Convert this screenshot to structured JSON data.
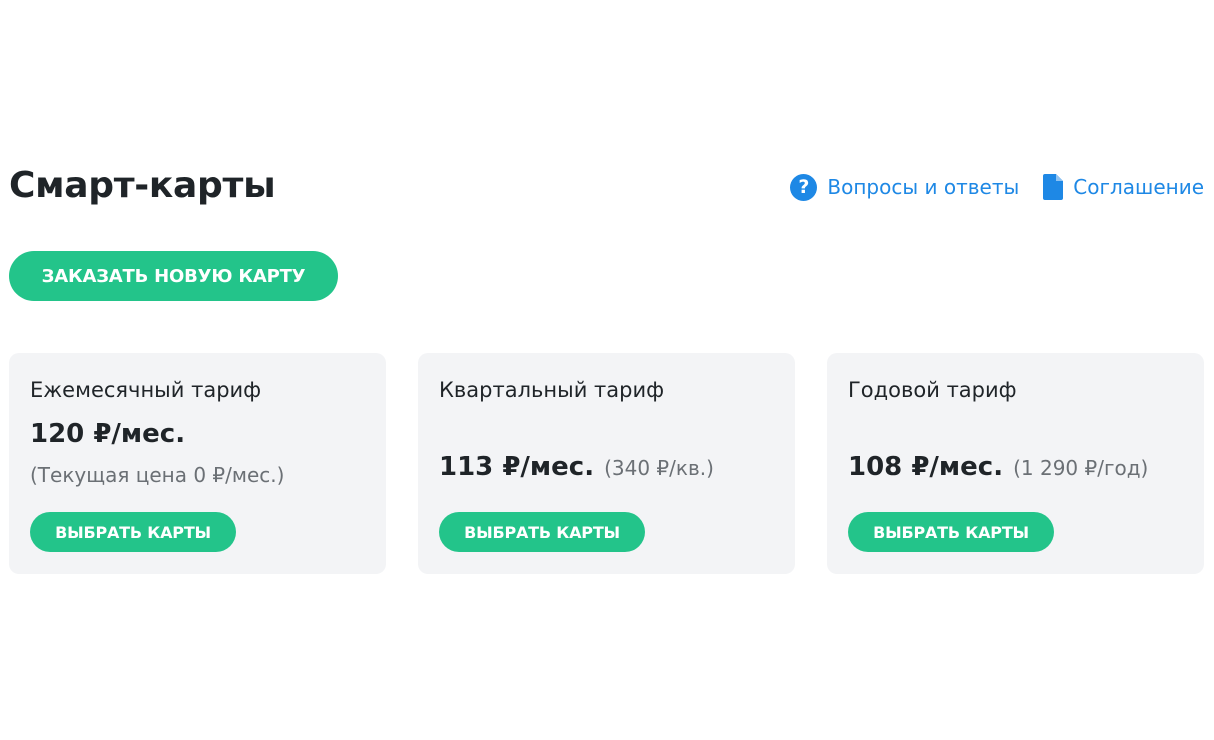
{
  "header": {
    "title": "Смарт-карты",
    "links": [
      {
        "label": "Вопросы и ответы",
        "icon": "help-circle-icon"
      },
      {
        "label": "Соглашение",
        "icon": "document-icon"
      }
    ]
  },
  "order_button": {
    "label": "ЗАКАЗАТЬ НОВУЮ КАРТУ"
  },
  "cards": [
    {
      "title": "Ежемесячный тариф",
      "price": "120 ₽/мес.",
      "note": "(Текущая цена 0 ₽/мес.)",
      "button_label": "ВЫБРАТЬ КАРТЫ"
    },
    {
      "title": "Квартальный тариф",
      "price": "113 ₽/мес.",
      "period_price": "(340 ₽/кв.)",
      "button_label": "ВЫБРАТЬ КАРТЫ"
    },
    {
      "title": "Годовой тариф",
      "price": "108 ₽/мес.",
      "period_price": "(1 290 ₽/год)",
      "button_label": "ВЫБРАТЬ КАРТЫ"
    }
  ],
  "colors": {
    "accent_green": "#23c48a",
    "link_blue": "#1e88e5",
    "card_bg": "#f3f4f6",
    "text_dark": "#1f2428",
    "text_muted": "#6b7075"
  }
}
